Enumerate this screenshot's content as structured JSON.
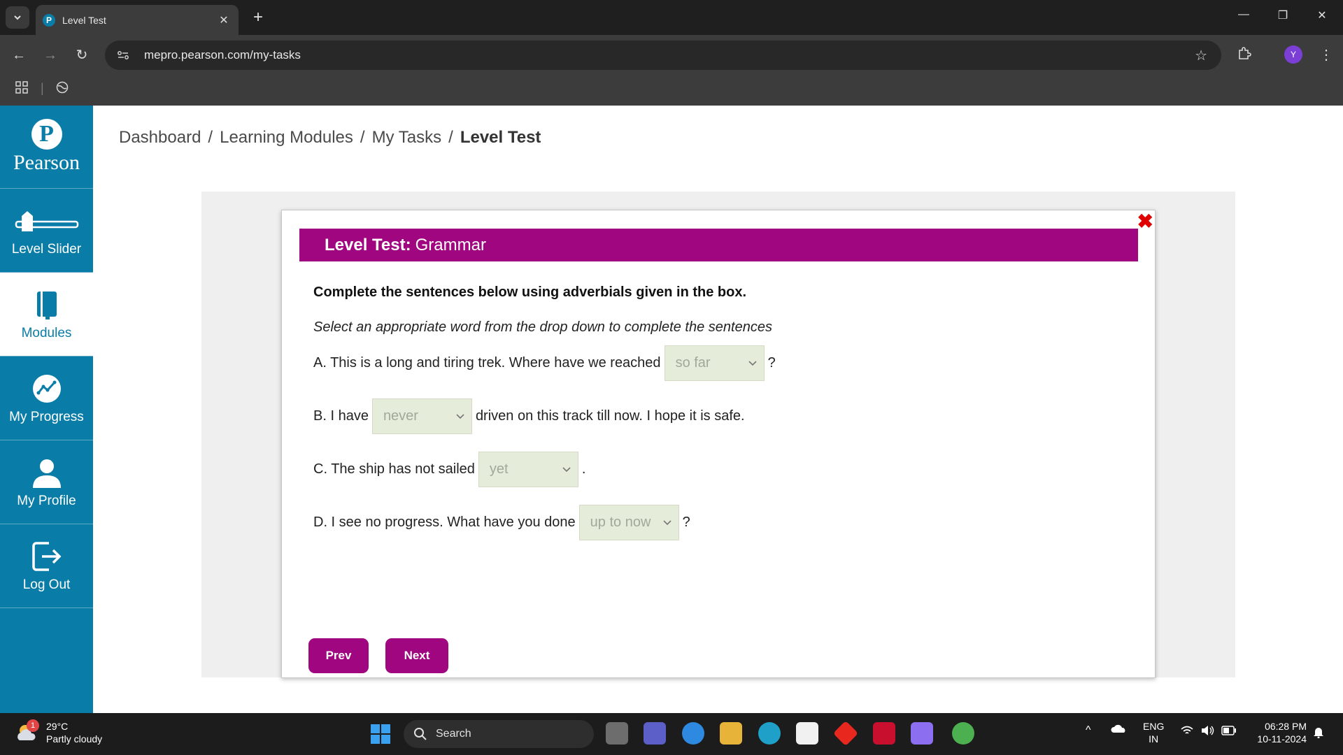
{
  "browser": {
    "tab_title": "Level Test",
    "favicon_letter": "P",
    "url": "mepro.pearson.com/my-tasks",
    "profile_initial": "Y"
  },
  "sidebar": {
    "brand": "Pearson",
    "brand_letter": "P",
    "items": [
      {
        "label": "Level Slider",
        "icon": "slider-icon"
      },
      {
        "label": "Modules",
        "icon": "book-icon",
        "active": true
      },
      {
        "label": "My Progress",
        "icon": "progress-chart-icon"
      },
      {
        "label": "My Profile",
        "icon": "user-icon"
      },
      {
        "label": "Log Out",
        "icon": "logout-icon"
      }
    ]
  },
  "breadcrumb": {
    "items": [
      "Dashboard",
      "Learning Modules",
      "My Tasks"
    ],
    "current": "Level Test",
    "separator": "/"
  },
  "modal": {
    "header_bold": "Level Test:",
    "header_rest": "Grammar",
    "instruction": "Complete the sentences below using adverbials given in the box.",
    "sub_instruction": "Select an appropriate word from the drop down to complete the sentences",
    "questions": [
      {
        "before": "A. This is a long and tiring trek. Where have we reached",
        "answer": "so far",
        "after": "?"
      },
      {
        "before": "B. I have",
        "answer": "never",
        "after": "driven on this track till now. I hope it is safe."
      },
      {
        "before": "C. The ship has not sailed",
        "answer": "yet",
        "after": "."
      },
      {
        "before": "D. I see no progress. What have you done",
        "answer": "up to now",
        "after": "?"
      }
    ],
    "prev_label": "Prev",
    "next_label": "Next",
    "accent_color": "#a0067f"
  },
  "taskbar": {
    "temperature": "29°C",
    "weather": "Partly cloudy",
    "weather_badge": "1",
    "search_placeholder": "Search",
    "lang_top": "ENG",
    "lang_bottom": "IN",
    "time": "06:28 PM",
    "date": "10-11-2024"
  }
}
